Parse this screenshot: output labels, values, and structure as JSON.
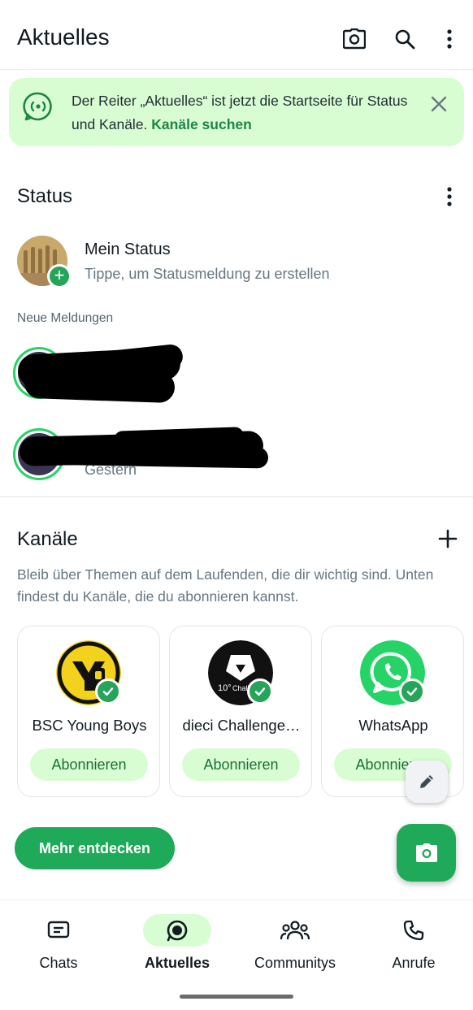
{
  "header": {
    "title": "Aktuelles",
    "icons": [
      "camera-icon",
      "search-icon",
      "more-vert-icon"
    ]
  },
  "banner": {
    "text": "Der Reiter „Aktuelles“ ist jetzt die Startseite für Status und Kanäle.",
    "link": "Kanäle suchen"
  },
  "status": {
    "heading": "Status",
    "my_status": {
      "name": "Mein Status",
      "subtitle": "Tippe, um Statusmeldung zu erstellen"
    },
    "new_label": "Neue Meldungen",
    "updates": [
      {
        "time": ""
      },
      {
        "time": "Gestern"
      }
    ]
  },
  "channels": {
    "heading": "Kanäle",
    "description": "Bleib über Themen auf dem Laufenden, die dir wichtig sind. Unten findest du Kanäle, die du abonnieren kannst.",
    "cards": [
      {
        "name": "BSC Young Boys",
        "button": "Abonnieren"
      },
      {
        "name": "dieci Challenge…",
        "button": "Abonnieren"
      },
      {
        "name": "WhatsApp",
        "button": "Abonnieren"
      }
    ],
    "discover": "Mehr entdecken"
  },
  "nav": {
    "items": [
      {
        "label": "Chats",
        "active": false
      },
      {
        "label": "Aktuelles",
        "active": true
      },
      {
        "label": "Communitys",
        "active": false
      },
      {
        "label": "Anrufe",
        "active": false
      }
    ]
  },
  "colors": {
    "accent": "#1faa59",
    "accent_light": "#d9fdd3",
    "text": "#111b21",
    "secondary_text": "#667781"
  }
}
